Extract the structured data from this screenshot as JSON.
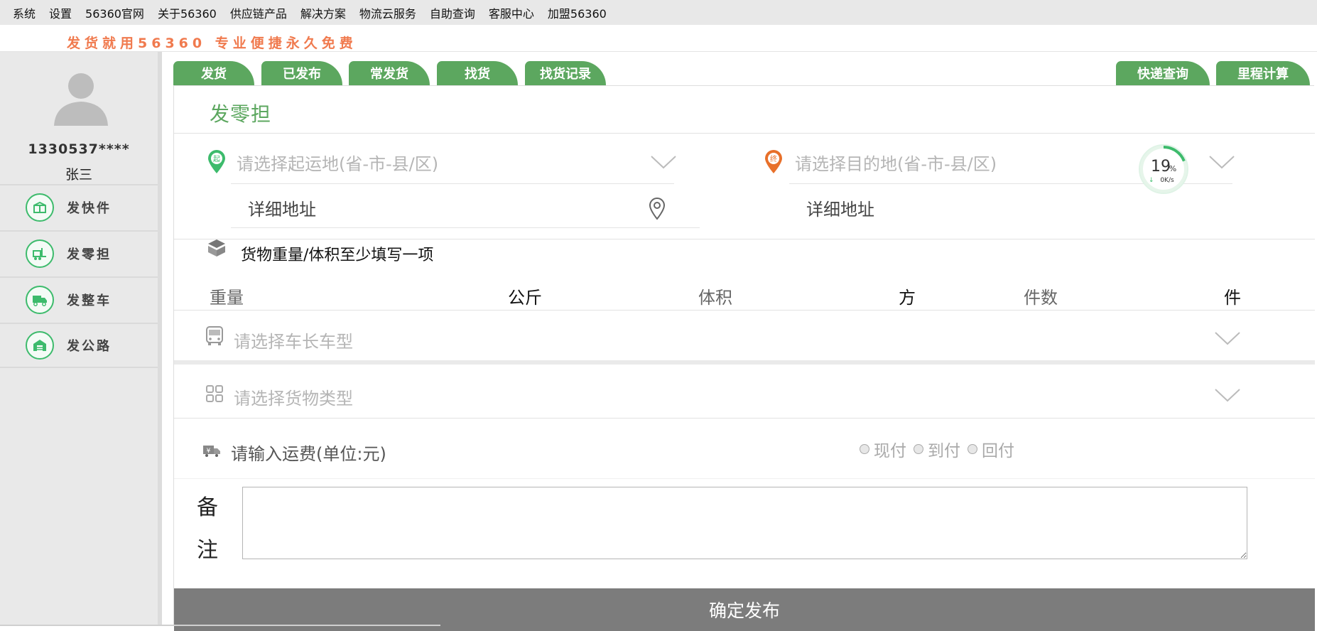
{
  "menu": [
    "系统",
    "设置",
    "56360官网",
    "关于56360",
    "供应链产品",
    "解决方案",
    "物流云服务",
    "自助查询",
    "客服中心",
    "加盟56360"
  ],
  "slogan": "发货就用56360 专业便捷永久免费",
  "user": {
    "phone": "1330537****",
    "name": "张三"
  },
  "sidebar": {
    "items": [
      {
        "label": "发快件",
        "icon": "package-icon"
      },
      {
        "label": "发零担",
        "icon": "forklift-icon"
      },
      {
        "label": "发整车",
        "icon": "truck-icon"
      },
      {
        "label": "发公路",
        "icon": "warehouse-icon"
      }
    ]
  },
  "tabs": {
    "left": [
      "发货",
      "已发布",
      "常发货",
      "找货",
      "找货记录"
    ],
    "right": [
      "快递查询",
      "里程计算"
    ]
  },
  "form": {
    "title": "发零担",
    "origin_placeholder": "请选择起运地(省-市-县/区)",
    "origin_badge": "起",
    "dest_placeholder": "请选择目的地(省-市-县/区)",
    "dest_badge": "终",
    "detail_address": "详细地址",
    "cargo_note": "货物重量/体积至少填写一项",
    "weight_label": "重量",
    "weight_unit": "公斤",
    "volume_label": "体积",
    "volume_unit": "方",
    "count_label": "件数",
    "count_unit": "件",
    "vehicle_placeholder": "请选择车长车型",
    "cargo_type_placeholder": "请选择货物类型",
    "freight_placeholder": "请输入运费(单位:元)",
    "payment_options": [
      "现付",
      "到付",
      "回付"
    ],
    "remark_label_1": "备",
    "remark_label_2": "注",
    "submit": "确定发布"
  },
  "gauge": {
    "percent": 19,
    "percent_text": "19",
    "percent_sign": "%",
    "speed": "0K/s"
  },
  "colors": {
    "green": "#5ca75f",
    "orange": "#f07a4e",
    "accent_green": "#3dbb6c",
    "pin_orange": "#e8702a"
  }
}
